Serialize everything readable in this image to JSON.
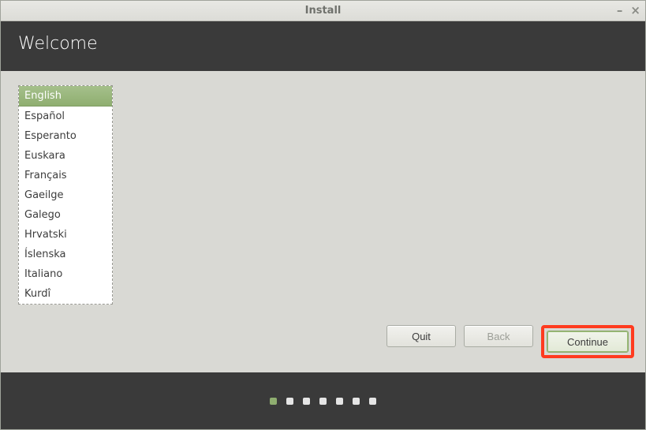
{
  "window": {
    "title": "Install"
  },
  "header": {
    "title": "Welcome"
  },
  "languages": {
    "selected_index": 0,
    "items": [
      "English",
      "Español",
      "Esperanto",
      "Euskara",
      "Français",
      "Gaeilge",
      "Galego",
      "Hrvatski",
      "Íslenska",
      "Italiano",
      "Kurdî"
    ]
  },
  "buttons": {
    "quit": "Quit",
    "back": "Back",
    "continue": "Continue"
  },
  "progress": {
    "total": 7,
    "active_index": 0
  }
}
